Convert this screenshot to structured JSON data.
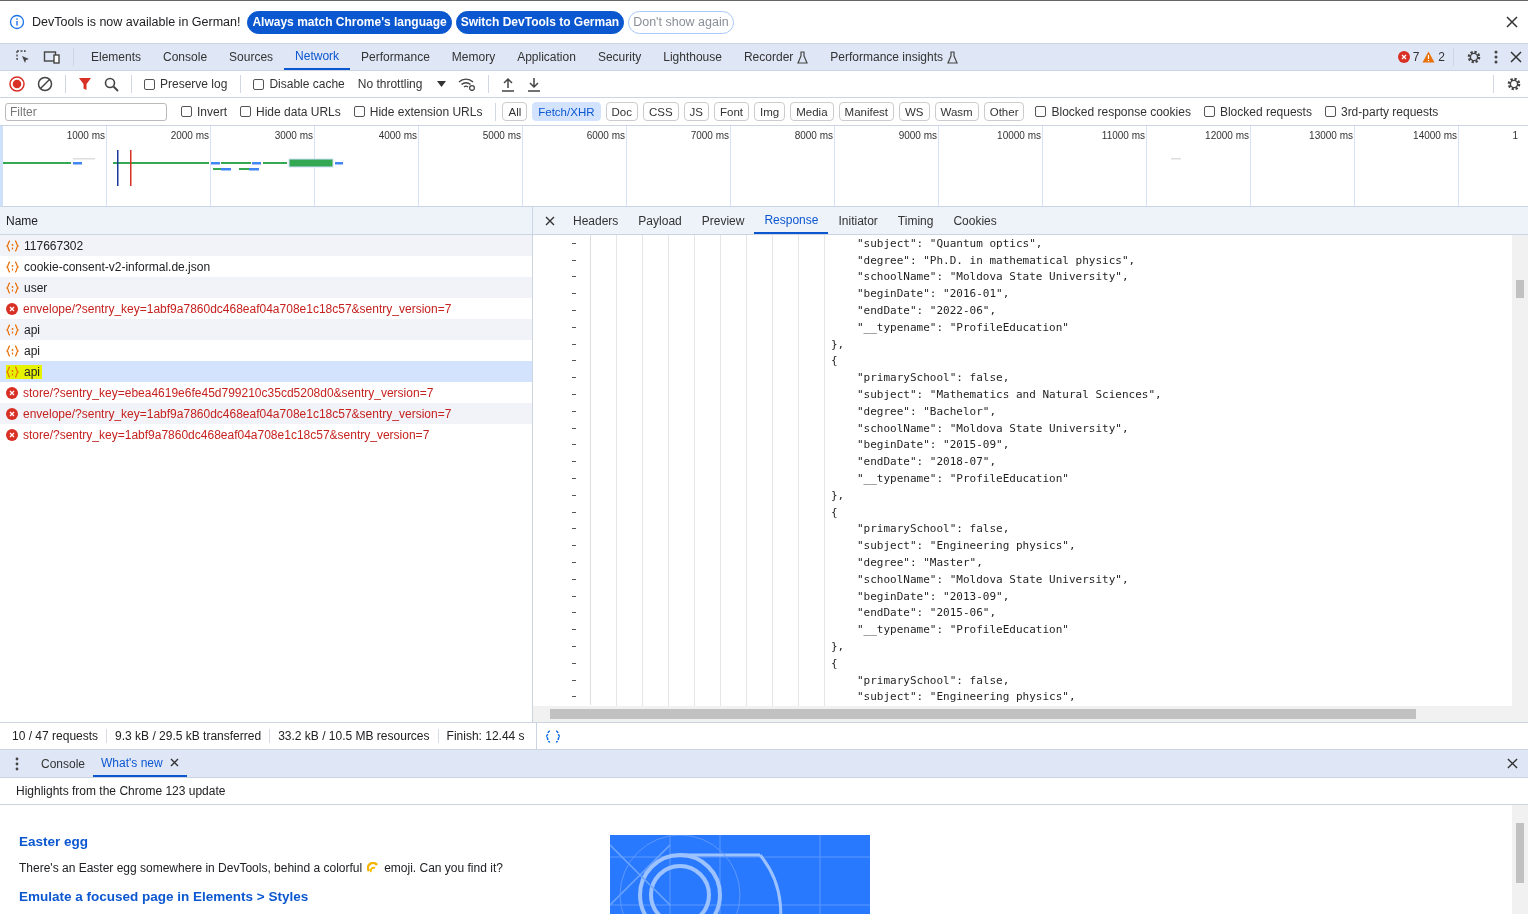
{
  "infobar": {
    "message": "DevTools is now available in German!",
    "buttons": [
      {
        "label": "Always match Chrome's language",
        "kind": "primary"
      },
      {
        "label": "Switch DevTools to German",
        "kind": "primary"
      },
      {
        "label": "Don't show again",
        "kind": "outline"
      }
    ]
  },
  "main_tabs": [
    {
      "label": "Elements",
      "selected": false,
      "experimental": false
    },
    {
      "label": "Console",
      "selected": false,
      "experimental": false
    },
    {
      "label": "Sources",
      "selected": false,
      "experimental": false
    },
    {
      "label": "Network",
      "selected": true,
      "experimental": false
    },
    {
      "label": "Performance",
      "selected": false,
      "experimental": false
    },
    {
      "label": "Memory",
      "selected": false,
      "experimental": false
    },
    {
      "label": "Application",
      "selected": false,
      "experimental": false
    },
    {
      "label": "Security",
      "selected": false,
      "experimental": false
    },
    {
      "label": "Lighthouse",
      "selected": false,
      "experimental": false
    },
    {
      "label": "Recorder",
      "selected": false,
      "experimental": true
    },
    {
      "label": "Performance insights",
      "selected": false,
      "experimental": true
    }
  ],
  "issues": {
    "errors": "7",
    "warnings": "2"
  },
  "toolbar": {
    "preserve_log": {
      "label": "Preserve log",
      "checked": false
    },
    "disable_cache": {
      "label": "Disable cache",
      "checked": false
    },
    "throttling": "No throttling"
  },
  "filter_bar": {
    "placeholder": "Filter",
    "checks_left": [
      {
        "label": "Invert",
        "checked": false
      },
      {
        "label": "Hide data URLs",
        "checked": false
      },
      {
        "label": "Hide extension URLs",
        "checked": false
      }
    ],
    "types": [
      {
        "label": "All",
        "selected": false
      },
      {
        "label": "Fetch/XHR",
        "selected": true
      },
      {
        "label": "Doc",
        "selected": false
      },
      {
        "label": "CSS",
        "selected": false
      },
      {
        "label": "JS",
        "selected": false
      },
      {
        "label": "Font",
        "selected": false
      },
      {
        "label": "Img",
        "selected": false
      },
      {
        "label": "Media",
        "selected": false
      },
      {
        "label": "Manifest",
        "selected": false
      },
      {
        "label": "WS",
        "selected": false
      },
      {
        "label": "Wasm",
        "selected": false
      },
      {
        "label": "Other",
        "selected": false
      }
    ],
    "checks_right": [
      {
        "label": "Blocked response cookies",
        "checked": false
      },
      {
        "label": "Blocked requests",
        "checked": false
      },
      {
        "label": "3rd-party requests",
        "checked": false
      }
    ]
  },
  "timeline": {
    "ticks": [
      "1000 ms",
      "2000 ms",
      "3000 ms",
      "4000 ms",
      "5000 ms",
      "6000 ms",
      "7000 ms",
      "8000 ms",
      "9000 ms",
      "10000 ms",
      "11000 ms",
      "12000 ms",
      "13000 ms",
      "14000 ms",
      "1"
    ]
  },
  "requests": {
    "column": "Name",
    "rows": [
      {
        "name": "117667302",
        "kind": "xhr",
        "selected": false,
        "highlighted": false
      },
      {
        "name": "cookie-consent-v2-informal.de.json",
        "kind": "xhr",
        "selected": false,
        "highlighted": false
      },
      {
        "name": "user",
        "kind": "xhr",
        "selected": false,
        "highlighted": false
      },
      {
        "name": "envelope/?sentry_key=1abf9a7860dc468eaf04a708e1c18c57&sentry_version=7",
        "kind": "error",
        "selected": false,
        "highlighted": false
      },
      {
        "name": "api",
        "kind": "xhr",
        "selected": false,
        "highlighted": false
      },
      {
        "name": "api",
        "kind": "xhr",
        "selected": false,
        "highlighted": false
      },
      {
        "name": "api",
        "kind": "xhr",
        "selected": true,
        "highlighted": true
      },
      {
        "name": "store/?sentry_key=ebea4619e6fe45d799210c35cd5208d0&sentry_version=7",
        "kind": "error",
        "selected": false,
        "highlighted": false
      },
      {
        "name": "envelope/?sentry_key=1abf9a7860dc468eaf04a708e1c18c57&sentry_version=7",
        "kind": "error",
        "selected": false,
        "highlighted": false
      },
      {
        "name": "store/?sentry_key=1abf9a7860dc468eaf04a708e1c18c57&sentry_version=7",
        "kind": "error",
        "selected": false,
        "highlighted": false
      }
    ]
  },
  "detail_tabs": [
    {
      "label": "Headers",
      "selected": false
    },
    {
      "label": "Payload",
      "selected": false
    },
    {
      "label": "Preview",
      "selected": false
    },
    {
      "label": "Response",
      "selected": true
    },
    {
      "label": "Initiator",
      "selected": false
    },
    {
      "label": "Timing",
      "selected": false
    },
    {
      "label": "Cookies",
      "selected": false
    }
  ],
  "response_lines": [
    {
      "kind": "prop",
      "text": "\"subject\": \"Quantum optics\","
    },
    {
      "kind": "prop",
      "text": "\"degree\": \"Ph.D. in mathematical physics\","
    },
    {
      "kind": "prop",
      "text": "\"schoolName\": \"Moldova State University\","
    },
    {
      "kind": "prop",
      "text": "\"beginDate\": \"2016-01\","
    },
    {
      "kind": "prop",
      "text": "\"endDate\": \"2022-06\","
    },
    {
      "kind": "prop",
      "text": "\"__typename\": \"ProfileEducation\""
    },
    {
      "kind": "brace",
      "text": "},"
    },
    {
      "kind": "brace",
      "text": "{"
    },
    {
      "kind": "prop",
      "text": "\"primarySchool\": false,"
    },
    {
      "kind": "prop",
      "text": "\"subject\": \"Mathematics and Natural Sciences\","
    },
    {
      "kind": "prop",
      "text": "\"degree\": \"Bachelor\","
    },
    {
      "kind": "prop",
      "text": "\"schoolName\": \"Moldova State University\","
    },
    {
      "kind": "prop",
      "text": "\"beginDate\": \"2015-09\","
    },
    {
      "kind": "prop",
      "text": "\"endDate\": \"2018-07\","
    },
    {
      "kind": "prop",
      "text": "\"__typename\": \"ProfileEducation\""
    },
    {
      "kind": "brace",
      "text": "},"
    },
    {
      "kind": "brace",
      "text": "{"
    },
    {
      "kind": "prop",
      "text": "\"primarySchool\": false,"
    },
    {
      "kind": "prop",
      "text": "\"subject\": \"Engineering physics\","
    },
    {
      "kind": "prop",
      "text": "\"degree\": \"Master\","
    },
    {
      "kind": "prop",
      "text": "\"schoolName\": \"Moldova State University\","
    },
    {
      "kind": "prop",
      "text": "\"beginDate\": \"2013-09\","
    },
    {
      "kind": "prop",
      "text": "\"endDate\": \"2015-06\","
    },
    {
      "kind": "prop",
      "text": "\"__typename\": \"ProfileEducation\""
    },
    {
      "kind": "brace",
      "text": "},"
    },
    {
      "kind": "brace",
      "text": "{"
    },
    {
      "kind": "prop",
      "text": "\"primarySchool\": false,"
    },
    {
      "kind": "prop",
      "text": "\"subject\": \"Engineering physics\","
    }
  ],
  "status_bar": [
    "10 / 47 requests",
    "9.3 kB / 29.5 kB transferred",
    "33.2 kB / 10.5 MB resources",
    "Finish: 12.44 s"
  ],
  "drawer": {
    "tabs": [
      {
        "label": "Console",
        "selected": false,
        "closable": false
      },
      {
        "label": "What's new",
        "selected": true,
        "closable": true
      }
    ],
    "header": "Highlights from the Chrome 123 update",
    "sections": [
      {
        "heading": "Easter egg",
        "text_before": "There's an Easter egg somewhere in DevTools, behind a colorful",
        "text_after": "emoji. Can you find it?"
      },
      {
        "heading": "Emulate a focused page in Elements > Styles"
      }
    ]
  }
}
